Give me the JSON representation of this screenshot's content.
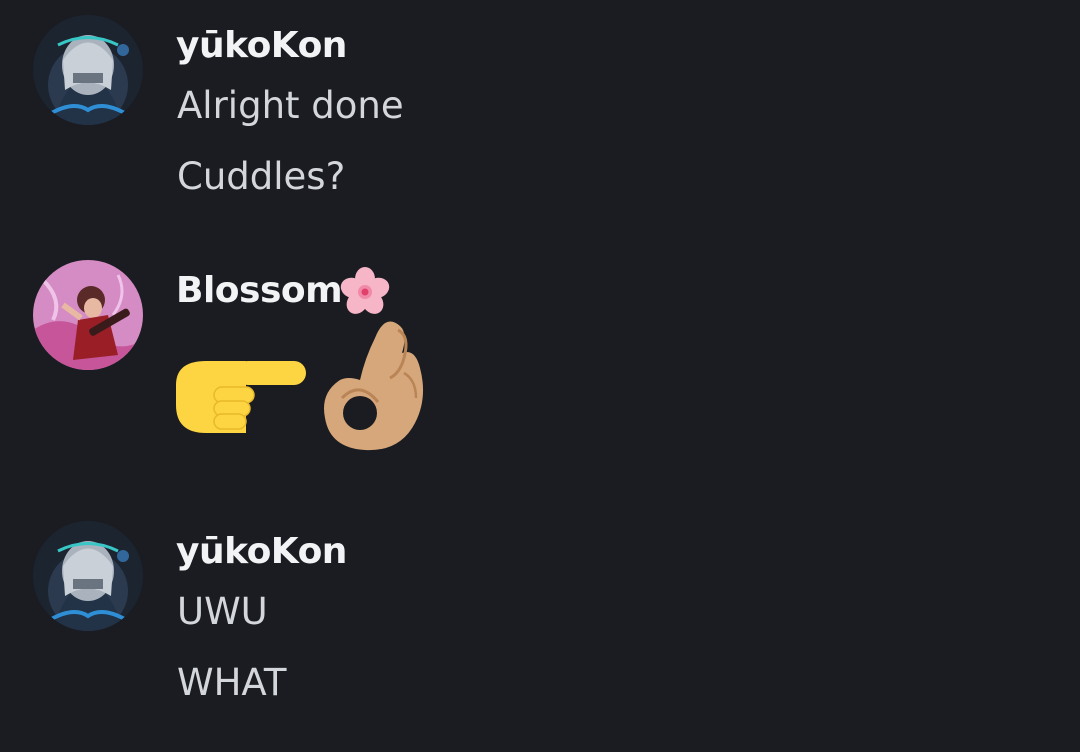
{
  "messages": [
    {
      "author": "yūkoKon",
      "lines": [
        "Alright done",
        "Cuddles?"
      ]
    },
    {
      "author": "Blossom",
      "author_emoji": "cherry-blossom",
      "lines": [],
      "emojis": [
        "backhand-index-pointing-right",
        "ok-hand-medium-light-skin-tone"
      ]
    },
    {
      "author": "yūkoKon",
      "lines": [
        "UWU",
        "WHAT"
      ]
    }
  ],
  "colors": {
    "background": "#1b1c21",
    "username": "#f2f3f5",
    "message_text": "#d3d6da"
  }
}
